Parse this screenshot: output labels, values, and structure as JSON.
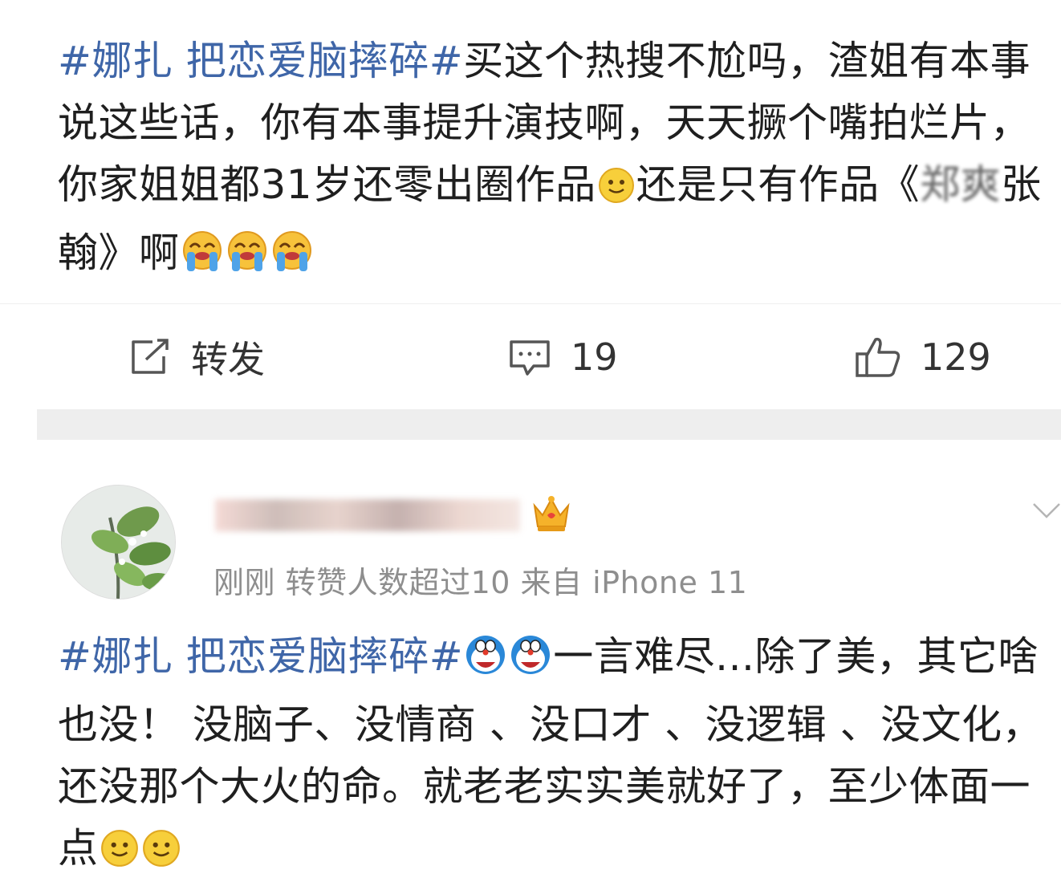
{
  "post1": {
    "text": {
      "tag": "#娜扎 把恋爱脑摔碎#",
      "part1": "买这个热搜不尬吗，渣姐有本事说这些话，你有本事提升演技啊，天天撅个嘴拍烂片，你家姐姐都31岁还零出圈作品",
      "part2": "还是只有作品《",
      "obscured": "郑爽",
      "part3": "张翰》啊"
    },
    "emoji": [
      "smile-emoji",
      "crying-emoji",
      "crying-emoji",
      "crying-emoji"
    ]
  },
  "actions": {
    "repost_label": "转发",
    "comment_count": "19",
    "like_count": "129"
  },
  "post2": {
    "username_hidden": true,
    "meta": "刚刚  转赞人数超过10   来自 iPhone 11",
    "text": {
      "tag": "#娜扎 把恋爱脑摔碎#",
      "body": "一言难尽...除了美，其它啥也没！ 没脑子、没情商 、没口才 、没逻辑 、没文化，还没那个大火的命。就老老实实美就好了，至少体面一点"
    },
    "emoji": [
      "doraemon-emoji",
      "doraemon-emoji",
      "smile-emoji",
      "smile-emoji"
    ]
  },
  "colors": {
    "tag": "#3f66a8",
    "text": "#1f1f1f",
    "meta": "#8e8e8e",
    "separator": "#eeeeee"
  }
}
